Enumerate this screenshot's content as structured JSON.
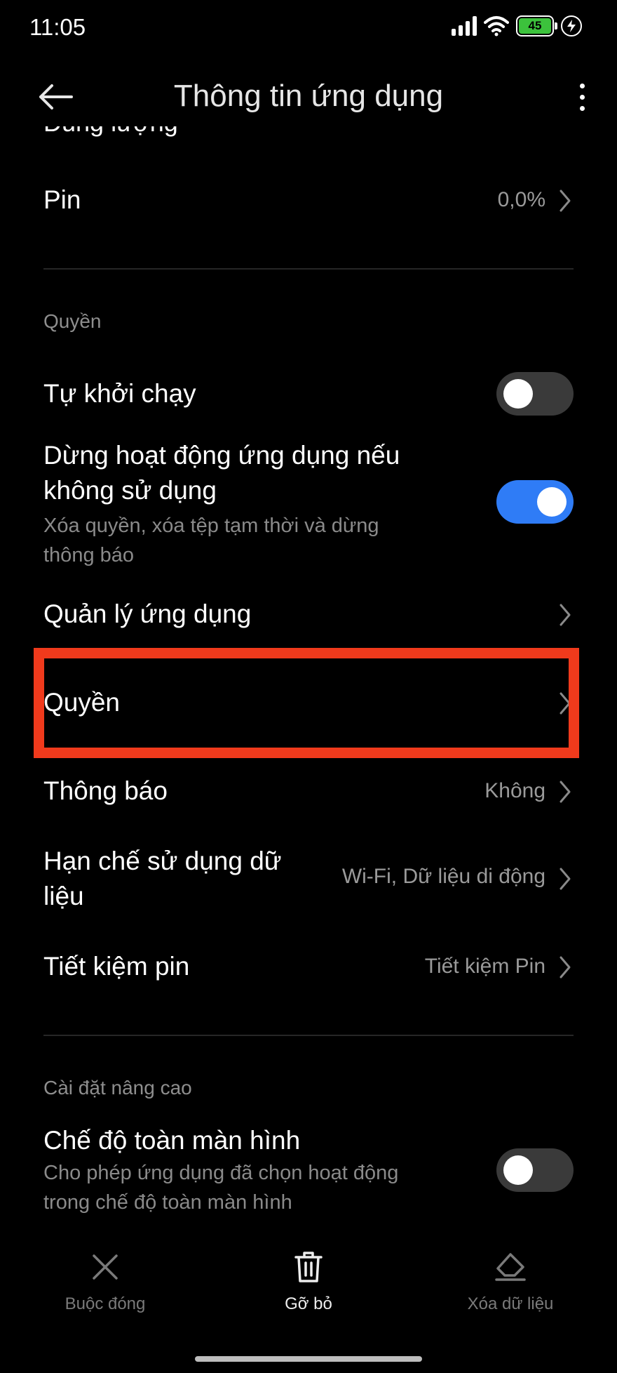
{
  "status": {
    "time": "11:05",
    "battery": "45"
  },
  "header": {
    "title": "Thông tin ứng dụng"
  },
  "clipped_text": "Dung lượng",
  "battery_row": {
    "title": "Pin",
    "value": "0,0%"
  },
  "permissions_section": {
    "header": "Quyền"
  },
  "autostart": {
    "title": "Tự khởi chạy",
    "enabled": false
  },
  "pause_app": {
    "title_line1": "Dừng hoạt động ứng dụng nếu",
    "title_line2": "không sử dụng",
    "sub_line1": "Xóa quyền, xóa tệp tạm thời và dừng",
    "sub_line2": "thông báo",
    "enabled": true
  },
  "manage_apps": {
    "title": "Quản lý ứng dụng"
  },
  "permissions_row": {
    "title": "Quyền"
  },
  "notifications": {
    "title": "Thông báo",
    "value": "Không"
  },
  "data_restrict": {
    "title_line1": "Hạn chế sử dụng dữ",
    "title_line2": "liệu",
    "value": "Wi-Fi, Dữ liệu di động"
  },
  "battery_saver": {
    "title": "Tiết kiệm pin",
    "value": "Tiết kiệm Pin"
  },
  "advanced_section": {
    "header": "Cài đặt nâng cao"
  },
  "fullscreen": {
    "title": "Chế độ toàn màn hình",
    "sub_line1": "Cho phép ứng dụng đã chọn hoạt động",
    "sub_line2": "trong chế độ toàn màn hình",
    "enabled": false
  },
  "bottom_actions": {
    "force_stop": "Buộc đóng",
    "uninstall": "Gỡ bỏ",
    "clear_data": "Xóa dữ liệu"
  },
  "colors": {
    "accent": "#2f7cf6",
    "highlight": "#f03a1c",
    "background": "#000000"
  },
  "icons": {
    "back": "back-arrow-icon",
    "more": "more-vertical-icon",
    "chevron": "chevron-right-icon",
    "force_stop": "close-icon",
    "uninstall": "trash-icon",
    "clear_data": "eraser-icon"
  }
}
